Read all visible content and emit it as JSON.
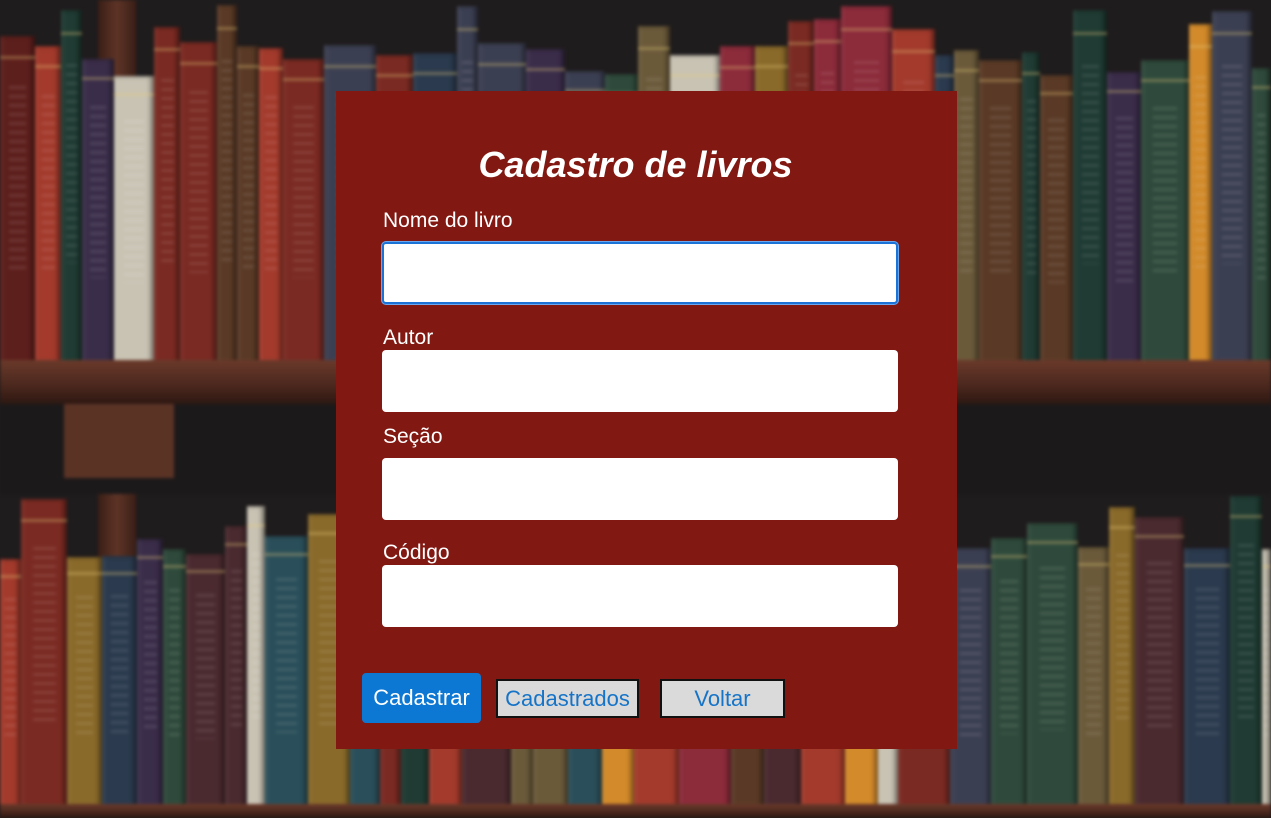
{
  "form": {
    "title": "Cadastro de livros",
    "fields": [
      {
        "label": "Nome do livro",
        "value": "",
        "placeholder": "",
        "focused": true
      },
      {
        "label": "Autor",
        "value": "",
        "placeholder": ""
      },
      {
        "label": "Seção",
        "value": "",
        "placeholder": ""
      },
      {
        "label": "Código",
        "value": "",
        "placeholder": ""
      }
    ]
  },
  "buttons": {
    "submit": "Cadastrar",
    "registered": "Cadastrados",
    "back": "Voltar"
  },
  "colors": {
    "card": "#821812",
    "primary": "#0c78d3",
    "focus_border": "#1b73d8",
    "secondary_bg": "#dadada",
    "secondary_text": "#1674c8"
  },
  "background": "bookshelf-photo"
}
